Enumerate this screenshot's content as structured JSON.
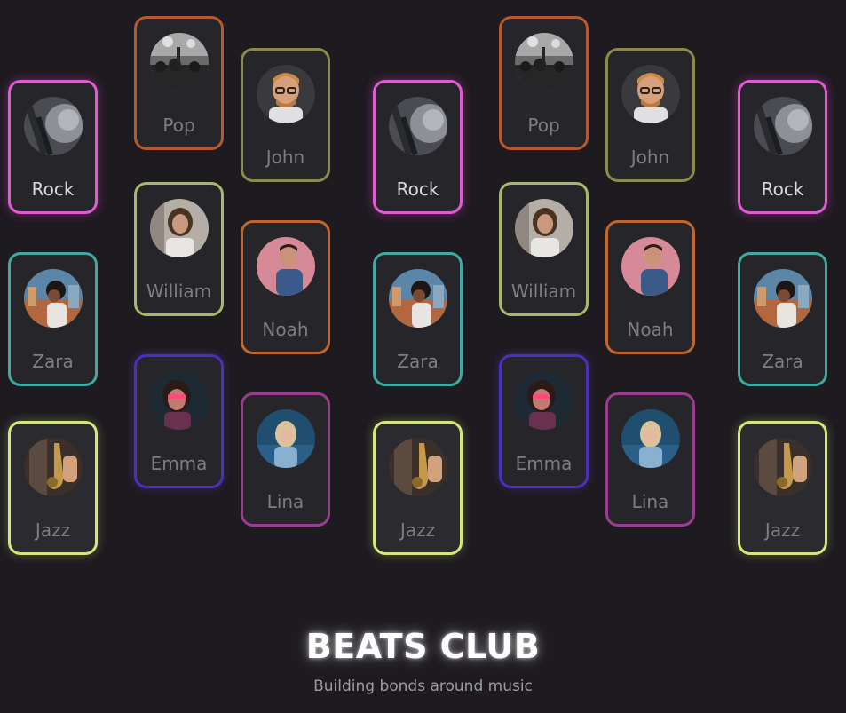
{
  "hero": {
    "title": "BEATS CLUB",
    "subtitle": "Building bonds around music"
  },
  "cards": [
    {
      "label": "Pop",
      "color": "#b9582f",
      "avatar": "concert-crowd-photo"
    },
    {
      "label": "John",
      "color": "#8a8a4a",
      "avatar": "man-with-glasses-photo"
    },
    {
      "label": "Rock",
      "color": "#e25ad4",
      "avatar": "guitar-photo"
    },
    {
      "label": "William",
      "color": "#a8b86a",
      "avatar": "man-long-hair-photo"
    },
    {
      "label": "Noah",
      "color": "#c2662f",
      "avatar": "man-pink-background-photo"
    },
    {
      "label": "Zara",
      "color": "#3fa9a2",
      "avatar": "woman-city-photo"
    },
    {
      "label": "Emma",
      "color": "#4a2fc0",
      "avatar": "woman-sunglasses-photo"
    },
    {
      "label": "Lina",
      "color": "#9a3c8f",
      "avatar": "woman-blonde-photo"
    },
    {
      "label": "Jazz",
      "color": "#d6e77a",
      "avatar": "saxophone-photo"
    }
  ]
}
